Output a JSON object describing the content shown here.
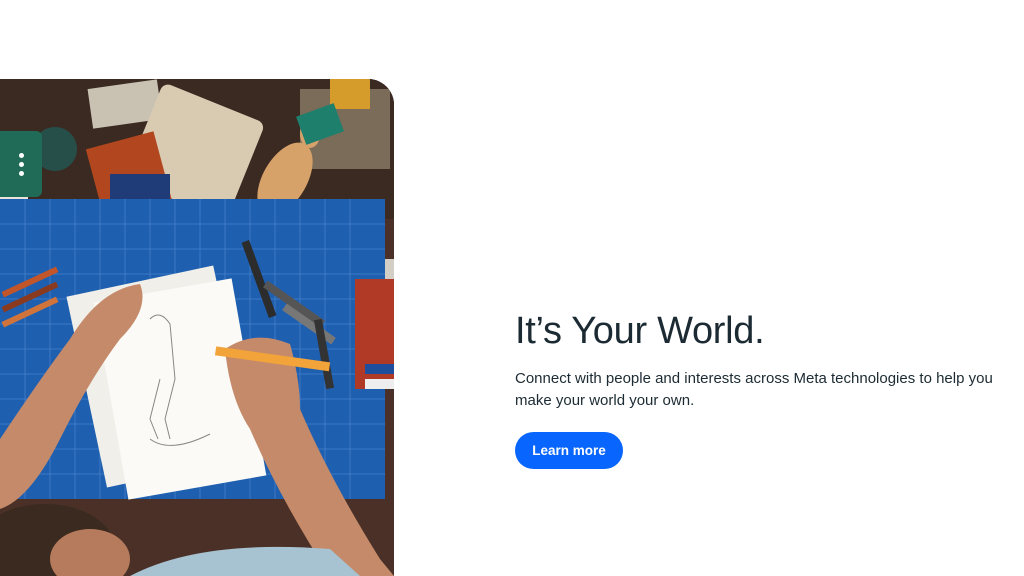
{
  "hero": {
    "title": "It’s Your World.",
    "body": "Connect with people and interests across Meta technologies to help you make your world your own.",
    "cta_label": "Learn more",
    "image_description_icon": "menu-dots-icon"
  },
  "colors": {
    "text": "#1c2b33",
    "cta_background": "#0866ff",
    "cta_text": "#ffffff",
    "background": "#ffffff",
    "menu_badge": "#1f6b57"
  }
}
